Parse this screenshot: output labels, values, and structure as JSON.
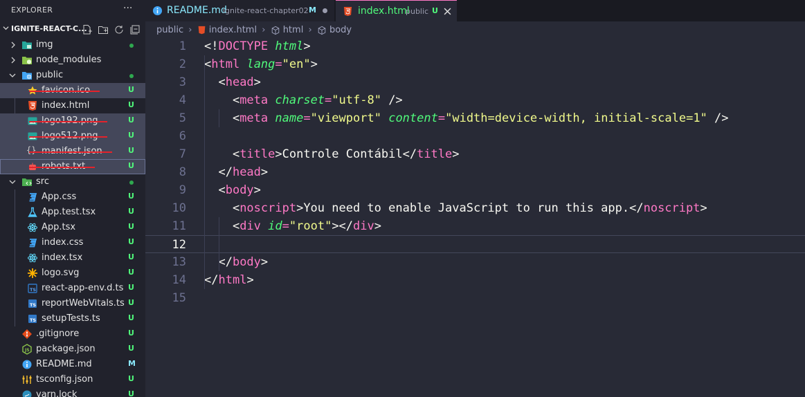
{
  "sidebar": {
    "title": "EXPLORER",
    "root": "IGNITE-REACT-C...",
    "items": [
      {
        "name": "img",
        "type": "folder",
        "status": "dot"
      },
      {
        "name": "node_modules",
        "type": "folder",
        "status": ""
      },
      {
        "name": "public",
        "type": "folder",
        "status": "dot"
      },
      {
        "name": "favicon.ico",
        "type": "file",
        "status": "U"
      },
      {
        "name": "index.html",
        "type": "file",
        "status": "U"
      },
      {
        "name": "logo192.png",
        "type": "file",
        "status": "U"
      },
      {
        "name": "logo512.png",
        "type": "file",
        "status": "U"
      },
      {
        "name": "manifest.json",
        "type": "file",
        "status": "U"
      },
      {
        "name": "robots.txt",
        "type": "file",
        "status": "U"
      },
      {
        "name": "src",
        "type": "folder",
        "status": "dot"
      },
      {
        "name": "App.css",
        "type": "file",
        "status": "U"
      },
      {
        "name": "App.test.tsx",
        "type": "file",
        "status": "U"
      },
      {
        "name": "App.tsx",
        "type": "file",
        "status": "U"
      },
      {
        "name": "index.css",
        "type": "file",
        "status": "U"
      },
      {
        "name": "index.tsx",
        "type": "file",
        "status": "U"
      },
      {
        "name": "logo.svg",
        "type": "file",
        "status": "U"
      },
      {
        "name": "react-app-env.d.ts",
        "type": "file",
        "status": "U"
      },
      {
        "name": "reportWebVitals.ts",
        "type": "file",
        "status": "U"
      },
      {
        "name": "setupTests.ts",
        "type": "file",
        "status": "U"
      },
      {
        "name": ".gitignore",
        "type": "file",
        "status": "U"
      },
      {
        "name": "package.json",
        "type": "file",
        "status": "U"
      },
      {
        "name": "README.md",
        "type": "file",
        "status": "M"
      },
      {
        "name": "tsconfig.json",
        "type": "file",
        "status": "U"
      },
      {
        "name": "yarn.lock",
        "type": "file",
        "status": "U"
      }
    ]
  },
  "tabs": [
    {
      "name": "README.md",
      "description": "ignite-react-chapter02",
      "status": "M"
    },
    {
      "name": "index.html",
      "description": "public",
      "status": "U"
    }
  ],
  "breadcrumb": [
    "public",
    "index.html",
    "html",
    "body"
  ],
  "editor": {
    "current_line": 12,
    "lines": [
      {
        "n": "1",
        "tokens": [
          [
            "p",
            "<!"
          ],
          [
            "t",
            "DOCTYPE"
          ],
          [
            "p",
            " "
          ],
          [
            "a",
            "html"
          ],
          [
            "p",
            ">"
          ]
        ]
      },
      {
        "n": "2",
        "tokens": [
          [
            "p",
            "<"
          ],
          [
            "t",
            "html"
          ],
          [
            "p",
            " "
          ],
          [
            "a",
            "lang"
          ],
          [
            "t",
            "="
          ],
          [
            "s",
            "\"en\""
          ],
          [
            "p",
            ">"
          ]
        ]
      },
      {
        "n": "3",
        "tokens": [
          [
            "p",
            "  <"
          ],
          [
            "t",
            "head"
          ],
          [
            "p",
            ">"
          ]
        ]
      },
      {
        "n": "4",
        "tokens": [
          [
            "p",
            "    <"
          ],
          [
            "t",
            "meta"
          ],
          [
            "p",
            " "
          ],
          [
            "a",
            "charset"
          ],
          [
            "t",
            "="
          ],
          [
            "s",
            "\"utf-8\""
          ],
          [
            "p",
            " />"
          ]
        ]
      },
      {
        "n": "5",
        "tokens": [
          [
            "p",
            "    <"
          ],
          [
            "t",
            "meta"
          ],
          [
            "p",
            " "
          ],
          [
            "a",
            "name"
          ],
          [
            "t",
            "="
          ],
          [
            "s",
            "\"viewport\""
          ],
          [
            "p",
            " "
          ],
          [
            "a",
            "content"
          ],
          [
            "t",
            "="
          ],
          [
            "s",
            "\"width=device-width, initial-scale=1\""
          ],
          [
            "p",
            " />"
          ]
        ]
      },
      {
        "n": "6",
        "tokens": []
      },
      {
        "n": "7",
        "tokens": [
          [
            "p",
            "    <"
          ],
          [
            "t",
            "title"
          ],
          [
            "p",
            ">Controle Contábil</"
          ],
          [
            "t",
            "title"
          ],
          [
            "p",
            ">"
          ]
        ]
      },
      {
        "n": "8",
        "tokens": [
          [
            "p",
            "  </"
          ],
          [
            "t",
            "head"
          ],
          [
            "p",
            ">"
          ]
        ]
      },
      {
        "n": "9",
        "tokens": [
          [
            "p",
            "  <"
          ],
          [
            "t",
            "body"
          ],
          [
            "p",
            ">"
          ]
        ]
      },
      {
        "n": "10",
        "tokens": [
          [
            "p",
            "    <"
          ],
          [
            "t",
            "noscript"
          ],
          [
            "p",
            ">You need to enable JavaScript to run this app.</"
          ],
          [
            "t",
            "noscript"
          ],
          [
            "p",
            ">"
          ]
        ]
      },
      {
        "n": "11",
        "tokens": [
          [
            "p",
            "    <"
          ],
          [
            "t",
            "div"
          ],
          [
            "p",
            " "
          ],
          [
            "a",
            "id"
          ],
          [
            "t",
            "="
          ],
          [
            "s",
            "\"root\""
          ],
          [
            "p",
            "></"
          ],
          [
            "t",
            "div"
          ],
          [
            "p",
            ">"
          ]
        ]
      },
      {
        "n": "12",
        "tokens": []
      },
      {
        "n": "13",
        "tokens": [
          [
            "p",
            "  </"
          ],
          [
            "t",
            "body"
          ],
          [
            "p",
            ">"
          ]
        ]
      },
      {
        "n": "14",
        "tokens": [
          [
            "p",
            "</"
          ],
          [
            "t",
            "html"
          ],
          [
            "p",
            ">"
          ]
        ]
      },
      {
        "n": "15",
        "tokens": []
      }
    ]
  },
  "colors": {
    "tag": "#ff79c6",
    "attr": "#50fa7b",
    "string": "#f1fa8c",
    "untracked": "#50fa7b",
    "modified": "#8be9fd"
  }
}
